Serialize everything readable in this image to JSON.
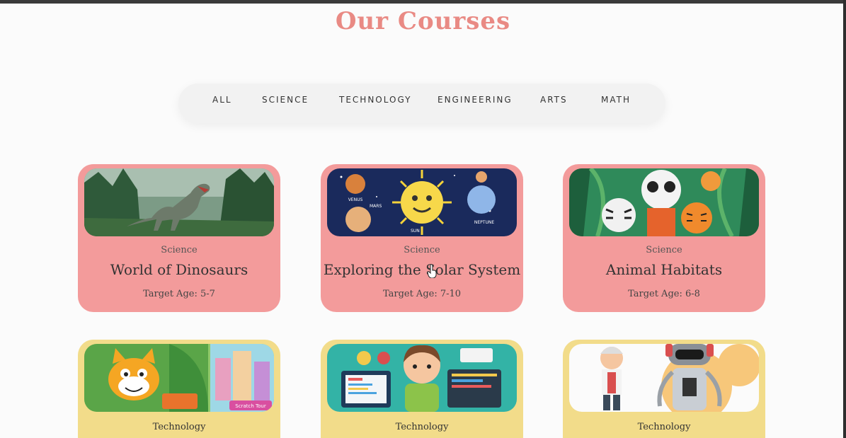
{
  "page": {
    "title": "Our Courses"
  },
  "filters": [
    {
      "label": "ALL"
    },
    {
      "label": "SCIENCE"
    },
    {
      "label": "TECHNOLOGY"
    },
    {
      "label": "ENGINEERING"
    },
    {
      "label": "ARTS"
    },
    {
      "label": "MATH"
    }
  ],
  "courses": [
    {
      "category": "Science",
      "title": "World of Dinosaurs",
      "age": "Target Age: 5-7",
      "image": "dinosaur-forest-image"
    },
    {
      "category": "Science",
      "title": "Exploring the Solar System",
      "age": "Target Age: 7-10",
      "image": "cartoon-solar-system-image",
      "image_text": [
        "VENUS",
        "MARS",
        "SUN",
        "NEPTUNE"
      ]
    },
    {
      "category": "Science",
      "title": "Animal Habitats",
      "age": "Target Age: 6-8",
      "image": "jungle-animals-image"
    },
    {
      "category": "Technology",
      "title": "",
      "age": "",
      "image": "scratch-cat-image",
      "image_text": [
        "Scratch Tour"
      ]
    },
    {
      "category": "Technology",
      "title": "",
      "age": "",
      "image": "kid-coding-image"
    },
    {
      "category": "Technology",
      "title": "",
      "age": "",
      "image": "scientist-and-robot-image"
    }
  ],
  "colors": {
    "title": "#e98a84",
    "science_card": "#f39b9b",
    "technology_card": "#f2dc8a",
    "filter_bar": "#f2f2f2"
  }
}
